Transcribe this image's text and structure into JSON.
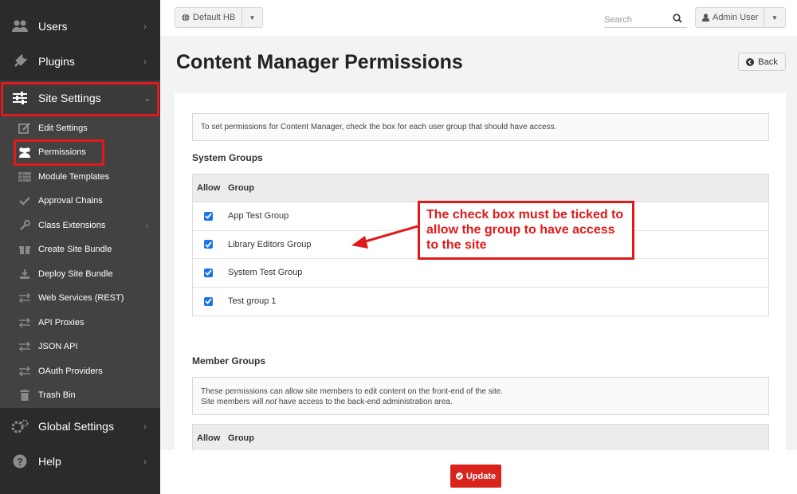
{
  "sidebar": {
    "main_items": [
      {
        "label": "Users",
        "icon": "users-icon"
      },
      {
        "label": "Plugins",
        "icon": "plug-icon"
      },
      {
        "label": "Site Settings",
        "icon": "sliders-icon"
      },
      {
        "label": "Global Settings",
        "icon": "gears-icon"
      },
      {
        "label": "Help",
        "icon": "question-icon"
      }
    ],
    "sub_items": [
      {
        "label": "Edit Settings",
        "icon": "edit-icon"
      },
      {
        "label": "Permissions",
        "icon": "users-icon"
      },
      {
        "label": "Module Templates",
        "icon": "table-icon"
      },
      {
        "label": "Approval Chains",
        "icon": "check-icon"
      },
      {
        "label": "Class Extensions",
        "icon": "wrench-icon"
      },
      {
        "label": "Create Site Bundle",
        "icon": "gift-icon"
      },
      {
        "label": "Deploy Site Bundle",
        "icon": "download-icon"
      },
      {
        "label": "Web Services (REST)",
        "icon": "exchange-icon"
      },
      {
        "label": "API Proxies",
        "icon": "exchange-icon"
      },
      {
        "label": "JSON API",
        "icon": "exchange-icon"
      },
      {
        "label": "OAuth Providers",
        "icon": "exchange-icon"
      },
      {
        "label": "Trash Bin",
        "icon": "trash-icon"
      }
    ]
  },
  "topbar": {
    "site_selector": "Default HB",
    "search_placeholder": "Search",
    "user_label": "Admin User"
  },
  "header": {
    "title": "Content Manager Permissions",
    "back_label": "Back"
  },
  "content": {
    "intro": "To set permissions for Content Manager, check the box for each user group that should have access.",
    "system_groups": {
      "heading": "System Groups",
      "col_allow": "Allow",
      "col_group": "Group",
      "rows": [
        {
          "group": "App Test Group",
          "checked": true
        },
        {
          "group": "Library Editors Group",
          "checked": true
        },
        {
          "group": "System Test Group",
          "checked": true
        },
        {
          "group": "Test group 1",
          "checked": true
        }
      ]
    },
    "member_groups": {
      "heading": "Member Groups",
      "info_line1": "These permissions can allow site members to edit content on the front-end of the site.",
      "info_line2_pre": "Site members will ",
      "info_line2_em": "not",
      "info_line2_post": " have access to the back-end administration area.",
      "col_allow": "Allow",
      "col_group": "Group"
    }
  },
  "footer": {
    "update_label": "Update"
  },
  "annotation": {
    "text": "The check box must be ticked to allow the group to have access to the site"
  },
  "colors": {
    "sidebar_bg": "#2b2b2b",
    "submenu_bg": "#424242",
    "highlight_red": "#e01a1a",
    "update_red": "#d9241e",
    "checkbox_blue": "#1a73e8"
  }
}
